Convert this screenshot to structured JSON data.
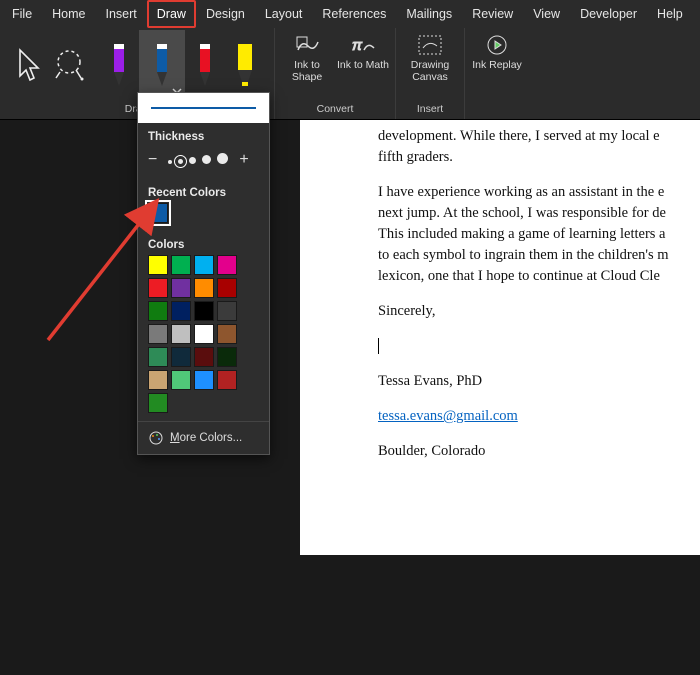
{
  "tabs": {
    "file": "File",
    "home": "Home",
    "insert": "Insert",
    "draw": "Draw",
    "design": "Design",
    "layout": "Layout",
    "references": "References",
    "mailings": "Mailings",
    "review": "Review",
    "view": "View",
    "developer": "Developer",
    "help": "Help"
  },
  "groups": {
    "draw": "Draw",
    "convert": "Convert",
    "insert": "Insert"
  },
  "buttons": {
    "ink_to_shape": "Ink to Shape",
    "ink_to_math": "Ink to Math",
    "drawing_canvas": "Drawing Canvas",
    "ink_replay": "Ink Replay"
  },
  "pen_menu": {
    "thickness": "Thickness",
    "recent": "Recent Colors",
    "colors": "Colors",
    "more": "More Colors...",
    "selected_color": "#0d5ba6",
    "thickness_options": [
      1,
      2,
      4,
      6,
      8
    ],
    "selected_thickness_index": 1,
    "recent_colors": [
      "#0d5ba6"
    ],
    "palette": [
      "#ffff00",
      "#00b050",
      "#00b0f0",
      "#e3008c",
      "#ed1c24",
      "#7030a0",
      "#ff8c00",
      "#a80000",
      "#107c10",
      "#002060",
      "#000000",
      "#3b3b3b",
      "#7a7a7a",
      "#bfbfbf",
      "#ffffff",
      "#8e562e",
      "#2e8b57",
      "#102a3b",
      "#5a0d0d",
      "#0a2a0a",
      "#caa472",
      "#50c878",
      "#1e90ff",
      "#b22222",
      "#228b22"
    ]
  },
  "document": {
    "p1a": "development. While there, I served at my local e",
    "p1b": "fifth graders.",
    "p2a": "I have experience working as an assistant in the e",
    "p2b": "next jump. At the school, I was responsible for de",
    "p2c": "This included making a game of learning letters a",
    "p2d": "to each symbol to ingrain them in the children's m",
    "p2e": "lexicon, one that I hope to continue at Cloud Cle",
    "p3": "Sincerely,",
    "name": "Tessa Evans, PhD",
    "email": "tessa.evans@gmail.com",
    "loc": "Boulder, Colorado"
  }
}
